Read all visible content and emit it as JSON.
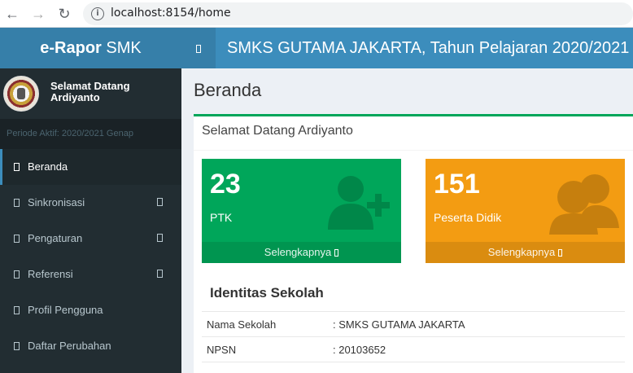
{
  "browser": {
    "url": "localhost:8154/home",
    "back_icon": "←",
    "forward_icon": "→",
    "reload_icon": "↻",
    "info_icon": "i"
  },
  "header": {
    "logo_bold": "e-Rapor",
    "logo_rest": " SMK",
    "school_title": "SMKS GUTAMA JAKARTA, Tahun Pelajaran 2020/2021"
  },
  "sidebar": {
    "welcome": "Selamat Datang Ardiyanto",
    "periode": "Periode Aktif: 2020/2021 Genap",
    "items": [
      {
        "label": "Beranda",
        "active": true,
        "has_chevron": false
      },
      {
        "label": "Sinkronisasi",
        "active": false,
        "has_chevron": true
      },
      {
        "label": "Pengaturan",
        "active": false,
        "has_chevron": true
      },
      {
        "label": "Referensi",
        "active": false,
        "has_chevron": true
      },
      {
        "label": "Profil Pengguna",
        "active": false,
        "has_chevron": false
      },
      {
        "label": "Daftar Perubahan",
        "active": false,
        "has_chevron": false
      }
    ]
  },
  "main": {
    "page_title": "Beranda",
    "box_title": "Selamat Datang Ardiyanto",
    "stats": [
      {
        "number": "23",
        "label": "PTK",
        "footer": "Selengkapnya",
        "color": "#00a65a",
        "icon": "user-plus-icon"
      },
      {
        "number": "151",
        "label": "Peserta Didik",
        "footer": "Selengkapnya",
        "color": "#f39c12",
        "icon": "users-icon"
      }
    ],
    "identitas_title": "Identitas Sekolah",
    "identitas": [
      {
        "key": "Nama Sekolah",
        "value": ": SMKS GUTAMA JAKARTA"
      },
      {
        "key": "NPSN",
        "value": ": 20103652"
      }
    ]
  },
  "colors": {
    "logo_bg": "#367fa9",
    "topbar_bg": "#3c8dbc",
    "sidebar_bg": "#222d32",
    "box_border": "#00a65a",
    "green": "#00a65a",
    "orange": "#f39c12"
  }
}
